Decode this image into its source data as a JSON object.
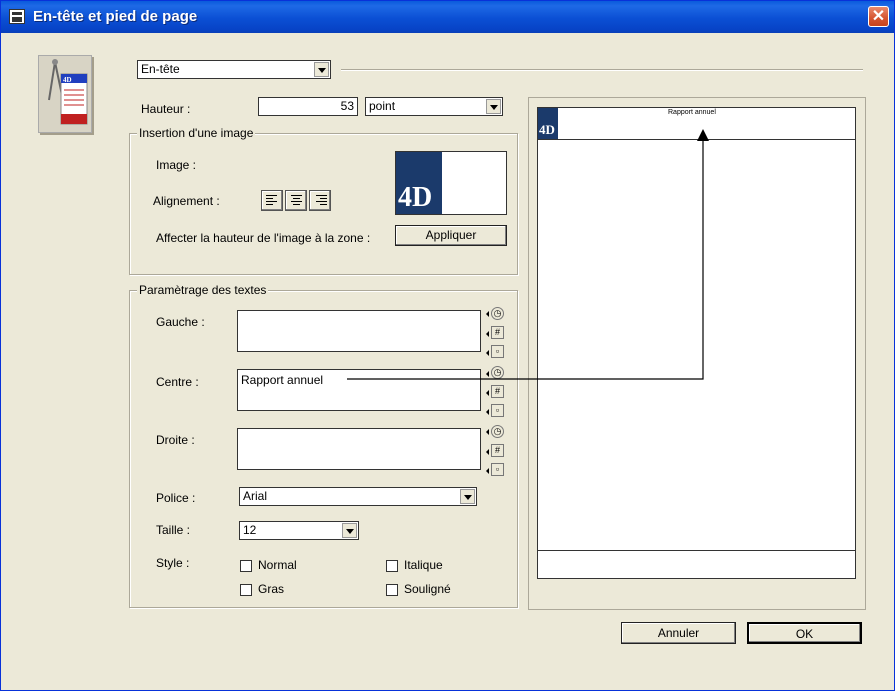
{
  "window": {
    "title": "En-tête et pied de page"
  },
  "header_select": {
    "value": "En-tête"
  },
  "height": {
    "label": "Hauteur :",
    "value": "53",
    "unit": "point"
  },
  "image_group": {
    "title": "Insertion d'une image",
    "image_label": "Image :",
    "alignment_label": "Alignement :",
    "affect_label": "Affecter la hauteur de l'image à la zone :",
    "apply_button": "Appliquer",
    "thumbnail_text": "4D"
  },
  "text_group": {
    "title": "Paramètrage des textes",
    "left_label": "Gauche :",
    "left_value": "",
    "center_label": "Centre :",
    "center_value": "Rapport annuel",
    "right_label": "Droite :",
    "right_value": "",
    "font_label": "Police :",
    "font_value": "Arial",
    "size_label": "Taille :",
    "size_value": "12",
    "style_label": "Style :",
    "styles": {
      "normal": "Normal",
      "italic": "Italique",
      "bold": "Gras",
      "underline": "Souligné"
    }
  },
  "preview": {
    "header_text": "Rapport annuel",
    "logo_text": "4D"
  },
  "buttons": {
    "cancel": "Annuler",
    "ok": "OK"
  },
  "colors": {
    "title_bar": "#0a5bdc",
    "dialog_bg": "#ece9d8",
    "logo_navy": "#1b3a6b"
  }
}
